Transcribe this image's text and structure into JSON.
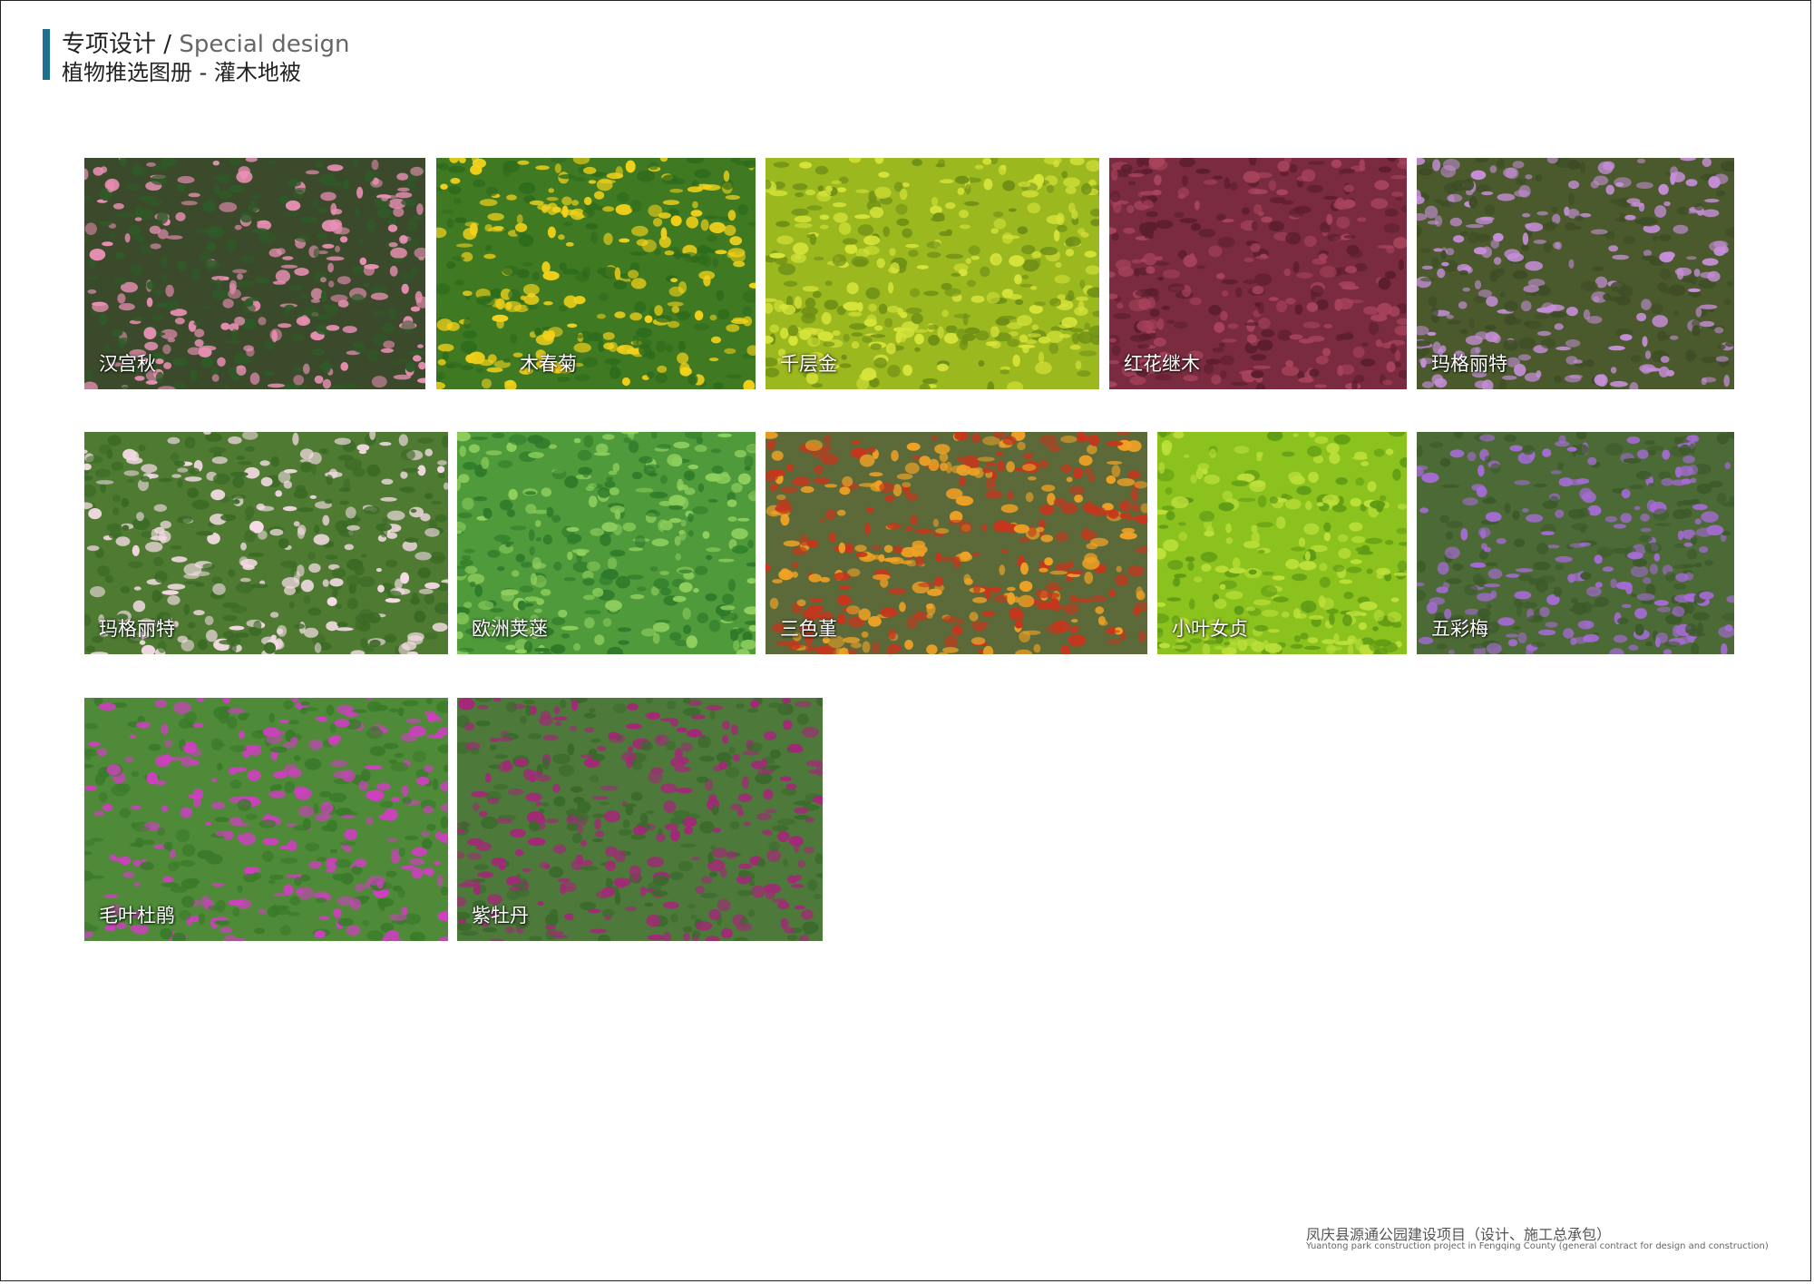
{
  "header": {
    "title_cn": "专项设计",
    "separator": " / ",
    "title_en": "Special design",
    "subtitle": "植物推选图册 - 灌木地被"
  },
  "plants": [
    {
      "name": "汉宫秋",
      "bg": "#3b4a2a",
      "flower": "#e98fb4",
      "leaf": "#2f5a28"
    },
    {
      "name": "木春菊",
      "bg": "#3f7a22",
      "flower": "#f5d21a",
      "leaf": "#2e6b1c"
    },
    {
      "name": "千层金",
      "bg": "#9bb81e",
      "flower": "#d7e43a",
      "leaf": "#6f8f16"
    },
    {
      "name": "红花继木",
      "bg": "#7a2b3f",
      "flower": "#a8445c",
      "leaf": "#5c1e2e"
    },
    {
      "name": "玛格丽特",
      "bg": "#4a5a2c",
      "flower": "#c68ed8",
      "leaf": "#3e4d26"
    },
    {
      "name": "玛格丽特",
      "bg": "#4e7a32",
      "flower": "#f4dbe4",
      "leaf": "#3b6a25"
    },
    {
      "name": "欧洲荚蒾",
      "bg": "#4f9a3a",
      "flower": "#8fcf5e",
      "leaf": "#2f7a2a"
    },
    {
      "name": "三色堇",
      "bg": "#5c6a3a",
      "flower": "#c7361c",
      "leaf": "#f0a224"
    },
    {
      "name": "小叶女贞",
      "bg": "#8cc21e",
      "flower": "#bde03a",
      "leaf": "#5e9a14"
    },
    {
      "name": "五彩梅",
      "bg": "#4c6a36",
      "flower": "#a56bd4",
      "leaf": "#3c5a2a"
    },
    {
      "name": "毛叶杜鹃",
      "bg": "#4e8a38",
      "flower": "#cf3fc0",
      "leaf": "#3a7a2a"
    },
    {
      "name": "紫牡丹",
      "bg": "#4d7a3a",
      "flower": "#a32877",
      "leaf": "#3a6a2c"
    }
  ],
  "footer": {
    "cn": "凤庆县源通公园建设项目（设计、施工总承包）",
    "en": "Yuantong park construction project in Fengqing County (general contract for design and construction)"
  }
}
